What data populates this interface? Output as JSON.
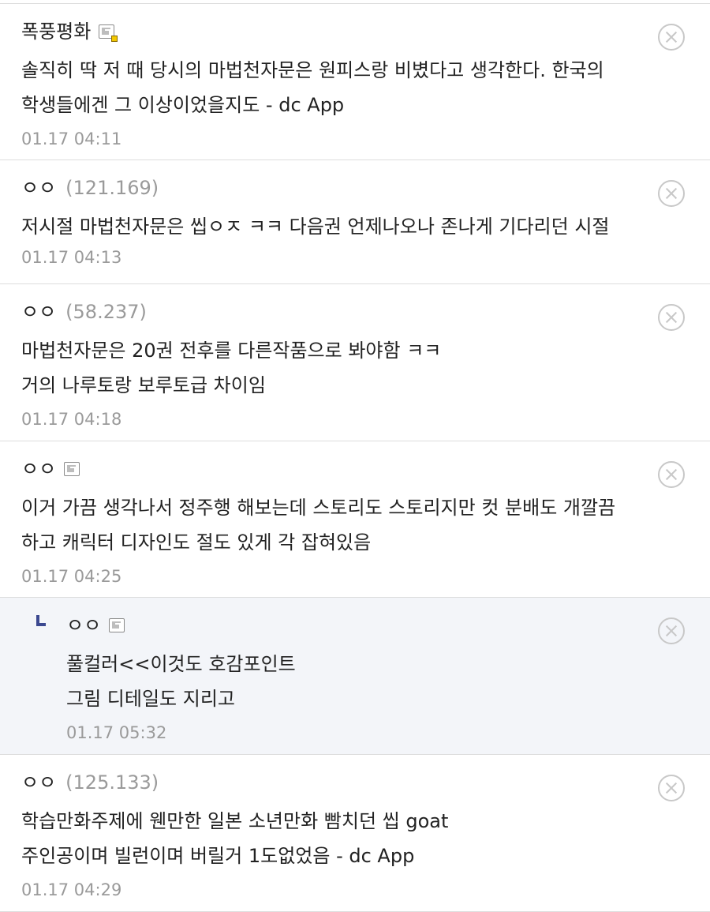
{
  "comments": [
    {
      "nick": "폭풍평화",
      "ip": "",
      "icon": "gonick-icon-with-badge",
      "lines": [
        "솔직히 딱 저 때 당시의 마법천자문은 원피스랑 비볐다고 생각한다. 한국의",
        "학생들에겐 그 이상이었을지도 - dc App"
      ],
      "date": "01.17 04:11"
    },
    {
      "nick": "ㅇㅇ",
      "ip": "(121.169)",
      "lines": [
        "저시절 마법천자문은 씹ㅇㅈ ㅋㅋ 다음권 언제나오나 존나게 기다리던 시절"
      ],
      "date": "01.17 04:13"
    },
    {
      "nick": "ㅇㅇ",
      "ip": "(58.237)",
      "lines": [
        "마법천자문은 20권 전후를 다른작품으로 봐야함 ㅋㅋ",
        "거의 나루토랑 보루토급 차이임"
      ],
      "date": "01.17 04:18"
    },
    {
      "nick": "ㅇㅇ",
      "ip": "",
      "icon": "gonick-icon",
      "lines": [
        "이거 가끔 생각나서 정주행 해보는데 스토리도 스토리지만 컷 분배도 개깔끔",
        "하고 캐릭터 디자인도 절도 있게 각 잡혀있음"
      ],
      "date": "01.17 04:25"
    },
    {
      "nick": "ㅇㅇ",
      "ip": "",
      "icon": "gonick-icon",
      "reply": true,
      "lines": [
        "풀컬러<<이것도 호감포인트",
        "그림 디테일도 지리고"
      ],
      "date": "01.17 05:32"
    },
    {
      "nick": "ㅇㅇ",
      "ip": "(125.133)",
      "lines": [
        "학습만화주제에 웬만한 일본 소년만화 빰치던 씹 goat",
        "주인공이며 빌런이며 버릴거 1도없었음 - dc App"
      ],
      "date": "01.17 04:29"
    }
  ],
  "colors": {
    "text": "#222222",
    "meta": "#9a9a9a",
    "divider": "#dddddd",
    "reply_bg": "#f3f5f9",
    "reply_mark": "#3b4890",
    "delete_icon": "#c8c8c8"
  }
}
